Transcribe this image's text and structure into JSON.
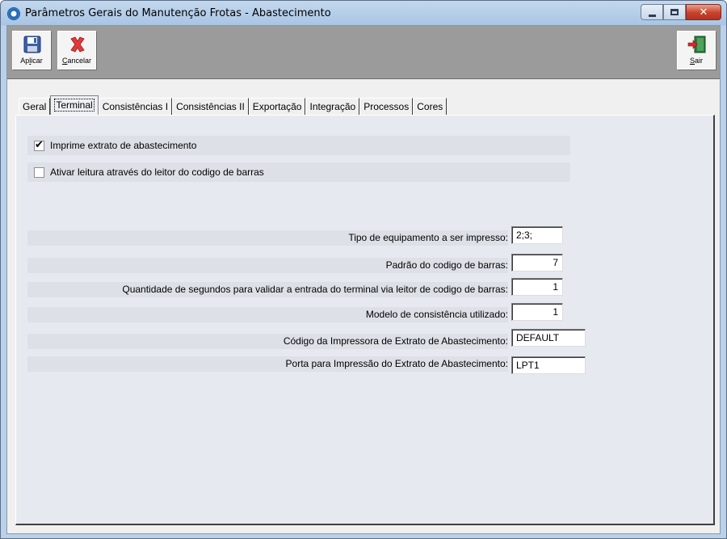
{
  "window": {
    "title": "Parâmetros Gerais do Manutenção Frotas - Abastecimento"
  },
  "toolbar": {
    "apply": {
      "pre": "Ap",
      "key": "l",
      "post": "icar",
      "icon": "floppy-disk-icon"
    },
    "cancel": {
      "pre": "",
      "key": "C",
      "post": "ancelar",
      "icon": "red-x-icon"
    },
    "exit": {
      "pre": "",
      "key": "S",
      "post": "air",
      "icon": "exit-door-icon"
    }
  },
  "tabs": [
    {
      "label": "Geral"
    },
    {
      "label": "Terminal",
      "active": true
    },
    {
      "label": "Consistências I"
    },
    {
      "label": "Consistências II"
    },
    {
      "label": "Exportação"
    },
    {
      "label": "Integração"
    },
    {
      "label": "Processos"
    },
    {
      "label": "Cores"
    }
  ],
  "terminal": {
    "print_receipt": {
      "label": "Imprime extrato de abastecimento",
      "checked": true
    },
    "barcode_reader": {
      "label": "Ativar leitura através do leitor do codigo de barras",
      "checked": false
    },
    "fields": [
      {
        "label": "Tipo de equipamento a ser impresso:",
        "value": "2;3;"
      },
      {
        "label": "Padrão do codigo de barras:",
        "value": "7"
      },
      {
        "label": "Quantidade de segundos para validar a entrada do terminal via leitor de codigo de barras:",
        "value": "1"
      },
      {
        "label": "Modelo de consistência utilizado:",
        "value": "1"
      },
      {
        "label": "Código da Impressora de Extrato de Abastecimento:",
        "value": "DEFAULT"
      },
      {
        "label": "Porta para Impressão do Extrato de Abastecimento:",
        "value": "LPT1"
      }
    ]
  }
}
